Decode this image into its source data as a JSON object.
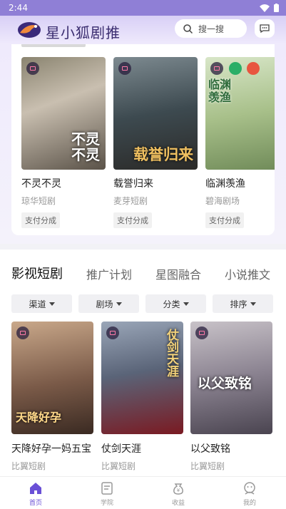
{
  "status_bar": {
    "time": "2:44"
  },
  "header": {
    "app_title": "星小狐剧推",
    "search_placeholder": "搜一搜"
  },
  "featured": [
    {
      "title": "不灵不灵",
      "studio": "琼华短剧",
      "badge": "支付分成",
      "poster_text": "不灵\n不灵"
    },
    {
      "title": "载誉归来",
      "studio": "麦芽短剧",
      "badge": "支付分成",
      "poster_text": "载誉归来"
    },
    {
      "title": "临渊羡渔",
      "studio": "碧海剧场",
      "badge": "支付分成",
      "poster_text": "临渊羡渔"
    }
  ],
  "tabs": [
    "影视短剧",
    "推广计划",
    "星图融合",
    "小说推文"
  ],
  "active_tab": "影视短剧",
  "filters": [
    "渠道",
    "剧场",
    "分类",
    "排序"
  ],
  "grid": [
    {
      "title": "天降好孕一妈五宝",
      "studio": "比翼短剧",
      "poster_text": "天降好孕"
    },
    {
      "title": "仗剑天涯",
      "studio": "比翼短剧",
      "poster_text": "仗剑天涯"
    },
    {
      "title": "以父致铭",
      "studio": "比翼短剧",
      "poster_text": "以父致铭"
    }
  ],
  "bottom_nav": [
    {
      "label": "首页",
      "icon": "home-icon"
    },
    {
      "label": "学院",
      "icon": "book-icon"
    },
    {
      "label": "收益",
      "icon": "money-icon"
    },
    {
      "label": "我的",
      "icon": "profile-icon"
    }
  ],
  "colors": {
    "accent": "#6a50d6",
    "header_bg": "#d8cff6",
    "title_color": "#3a2c6f"
  }
}
